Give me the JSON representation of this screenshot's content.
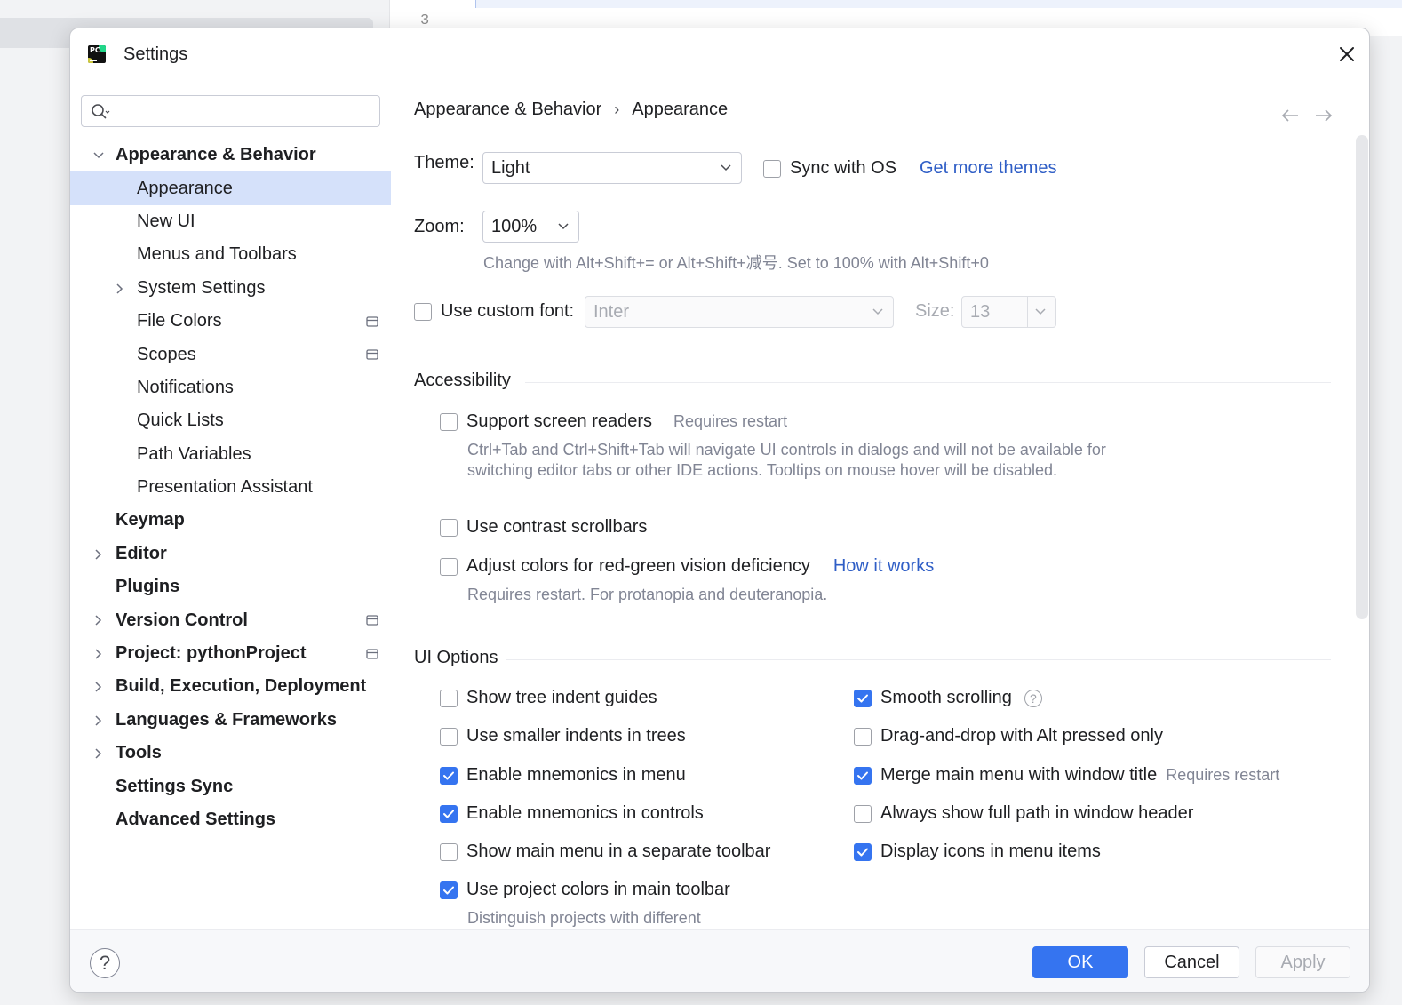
{
  "background": {
    "line_number": "3"
  },
  "window": {
    "title": "Settings",
    "app_icon_text": "PC"
  },
  "search": {
    "placeholder": "",
    "value": ""
  },
  "tree": [
    {
      "label": "Appearance & Behavior",
      "level": 0,
      "chevron": "expanded",
      "selected": false,
      "project_icon": false
    },
    {
      "label": "Appearance",
      "level": 1,
      "chevron": "none",
      "selected": true,
      "project_icon": false
    },
    {
      "label": "New UI",
      "level": 1,
      "chevron": "none",
      "selected": false,
      "project_icon": false
    },
    {
      "label": "Menus and Toolbars",
      "level": 1,
      "chevron": "none",
      "selected": false,
      "project_icon": false
    },
    {
      "label": "System Settings",
      "level": 1,
      "chevron": "collapsed",
      "selected": false,
      "project_icon": false
    },
    {
      "label": "File Colors",
      "level": 1,
      "chevron": "none",
      "selected": false,
      "project_icon": true
    },
    {
      "label": "Scopes",
      "level": 1,
      "chevron": "none",
      "selected": false,
      "project_icon": true
    },
    {
      "label": "Notifications",
      "level": 1,
      "chevron": "none",
      "selected": false,
      "project_icon": false
    },
    {
      "label": "Quick Lists",
      "level": 1,
      "chevron": "none",
      "selected": false,
      "project_icon": false
    },
    {
      "label": "Path Variables",
      "level": 1,
      "chevron": "none",
      "selected": false,
      "project_icon": false
    },
    {
      "label": "Presentation Assistant",
      "level": 1,
      "chevron": "none",
      "selected": false,
      "project_icon": false
    },
    {
      "label": "Keymap",
      "level": 0,
      "chevron": "none",
      "selected": false,
      "project_icon": false
    },
    {
      "label": "Editor",
      "level": 0,
      "chevron": "collapsed",
      "selected": false,
      "project_icon": false
    },
    {
      "label": "Plugins",
      "level": 0,
      "chevron": "none",
      "selected": false,
      "project_icon": false
    },
    {
      "label": "Version Control",
      "level": 0,
      "chevron": "collapsed",
      "selected": false,
      "project_icon": true
    },
    {
      "label": "Project: pythonProject",
      "level": 0,
      "chevron": "collapsed",
      "selected": false,
      "project_icon": true
    },
    {
      "label": "Build, Execution, Deployment",
      "level": 0,
      "chevron": "collapsed",
      "selected": false,
      "project_icon": false
    },
    {
      "label": "Languages & Frameworks",
      "level": 0,
      "chevron": "collapsed",
      "selected": false,
      "project_icon": false
    },
    {
      "label": "Tools",
      "level": 0,
      "chevron": "collapsed",
      "selected": false,
      "project_icon": false
    },
    {
      "label": "Settings Sync",
      "level": 0,
      "chevron": "none",
      "selected": false,
      "project_icon": false
    },
    {
      "label": "Advanced Settings",
      "level": 0,
      "chevron": "none",
      "selected": false,
      "project_icon": false
    }
  ],
  "breadcrumb": {
    "parent": "Appearance & Behavior",
    "separator": "›",
    "current": "Appearance"
  },
  "theme": {
    "label": "Theme:",
    "value": "Light",
    "sync_label": "Sync with OS",
    "sync_checked": false,
    "more_link": "Get more themes"
  },
  "zoom": {
    "label": "Zoom:",
    "value": "100%",
    "hint": "Change with Alt+Shift+= or Alt+Shift+减号. Set to 100% with Alt+Shift+0"
  },
  "custom_font": {
    "label": "Use custom font:",
    "checked": false,
    "font_value": "Inter",
    "size_label": "Size:",
    "size_value": "13"
  },
  "accessibility": {
    "title": "Accessibility",
    "screen_readers": {
      "label": "Support screen readers",
      "checked": false,
      "note": "Requires restart",
      "description": "Ctrl+Tab and Ctrl+Shift+Tab will navigate UI controls in dialogs and will not be available for switching editor tabs or other IDE actions. Tooltips on mouse hover will be disabled."
    },
    "contrast_scrollbars": {
      "label": "Use contrast scrollbars",
      "checked": false
    },
    "color_deficiency": {
      "label": "Adjust colors for red-green vision deficiency",
      "checked": false,
      "link": "How it works",
      "description": "Requires restart. For protanopia and deuteranopia."
    }
  },
  "ui_options": {
    "title": "UI Options",
    "left": [
      {
        "label": "Show tree indent guides",
        "checked": false
      },
      {
        "label": "Use smaller indents in trees",
        "checked": false
      },
      {
        "label": "Enable mnemonics in menu",
        "checked": true
      },
      {
        "label": "Enable mnemonics in controls",
        "checked": true
      },
      {
        "label": "Show main menu in a separate toolbar",
        "checked": false
      },
      {
        "label": "Use project colors in main toolbar",
        "checked": true
      }
    ],
    "left_trailing_hint": "Distinguish projects with different",
    "right": [
      {
        "label": "Smooth scrolling",
        "checked": true,
        "note": ""
      },
      {
        "label": "Drag-and-drop with Alt pressed only",
        "checked": false,
        "note": ""
      },
      {
        "label": "Merge main menu with window title",
        "checked": true,
        "note": "Requires restart"
      },
      {
        "label": "Always show full path in window header",
        "checked": false,
        "note": ""
      },
      {
        "label": "Display icons in menu items",
        "checked": true,
        "note": ""
      }
    ],
    "help_glyph": "?"
  },
  "footer": {
    "help": "?",
    "ok": "OK",
    "cancel": "Cancel",
    "apply": "Apply"
  },
  "colors": {
    "accent": "#3574f0",
    "link": "#2f5ec6",
    "selection": "#d5e1fa",
    "hint_text": "#818594"
  }
}
